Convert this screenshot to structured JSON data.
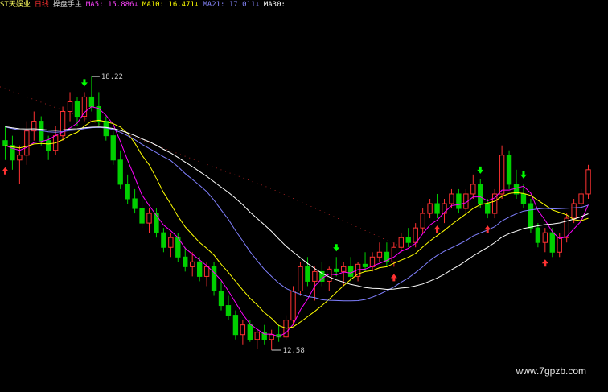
{
  "header": {
    "stock_name": "ST天娱业",
    "period": "日线",
    "indicator_name": "操盘手主",
    "ma5": "MA5: 15.886↓",
    "ma10": "MA10: 16.471↓",
    "ma21": "MA21: 17.011↓",
    "ma30": "MA30:"
  },
  "watermark": "www.7gpzb.com",
  "colors": {
    "up": "#ff3232",
    "down": "#00d000",
    "ma5": "#ff00ff",
    "ma10": "#ffff00",
    "ma21": "#8080ff",
    "ma30": "#ffffff",
    "dotted": "#ff3232",
    "buy": "#ff3232",
    "sell": "#00ff00"
  },
  "chart_data": {
    "type": "candlestick",
    "title": "",
    "ylim": [
      11.8,
      19.5
    ],
    "annotations": {
      "high": {
        "label": "18.22",
        "value": 18.22
      },
      "low": {
        "label": "12.58",
        "value": 12.58
      }
    },
    "candles": [
      [
        16.9,
        17.2,
        16.5,
        16.8
      ],
      [
        16.8,
        17.0,
        16.3,
        16.5
      ],
      [
        16.5,
        16.8,
        16.0,
        16.6
      ],
      [
        16.6,
        17.3,
        16.4,
        17.1
      ],
      [
        17.1,
        17.5,
        16.9,
        17.3
      ],
      [
        17.3,
        17.4,
        16.8,
        16.9
      ],
      [
        16.9,
        17.0,
        16.5,
        16.7
      ],
      [
        16.7,
        17.2,
        16.6,
        17.0
      ],
      [
        17.0,
        17.6,
        16.9,
        17.5
      ],
      [
        17.5,
        17.9,
        17.3,
        17.7
      ],
      [
        17.7,
        17.8,
        17.2,
        17.4
      ],
      [
        17.4,
        17.9,
        17.3,
        17.8
      ],
      [
        17.8,
        18.22,
        17.5,
        17.6
      ],
      [
        17.6,
        17.9,
        17.2,
        17.3
      ],
      [
        17.3,
        17.4,
        16.9,
        17.0
      ],
      [
        17.0,
        17.1,
        16.4,
        16.5
      ],
      [
        16.5,
        16.7,
        15.9,
        16.0
      ],
      [
        16.0,
        16.2,
        15.6,
        15.7
      ],
      [
        15.7,
        15.9,
        15.4,
        15.5
      ],
      [
        15.5,
        15.7,
        15.1,
        15.2
      ],
      [
        15.2,
        15.5,
        15.0,
        15.4
      ],
      [
        15.4,
        15.5,
        14.9,
        15.0
      ],
      [
        15.0,
        15.1,
        14.6,
        14.7
      ],
      [
        14.7,
        15.0,
        14.5,
        14.9
      ],
      [
        14.9,
        15.0,
        14.4,
        14.5
      ],
      [
        14.5,
        14.7,
        14.2,
        14.3
      ],
      [
        14.3,
        14.6,
        14.1,
        14.4
      ],
      [
        14.4,
        14.5,
        14.0,
        14.1
      ],
      [
        14.1,
        14.4,
        13.9,
        14.3
      ],
      [
        14.3,
        14.4,
        13.7,
        13.8
      ],
      [
        13.8,
        14.0,
        13.4,
        13.5
      ],
      [
        13.5,
        13.7,
        13.2,
        13.3
      ],
      [
        13.3,
        13.4,
        12.8,
        12.9
      ],
      [
        12.9,
        13.2,
        12.7,
        13.1
      ],
      [
        13.1,
        13.2,
        12.75,
        12.8
      ],
      [
        12.8,
        13.0,
        12.6,
        12.95
      ],
      [
        12.95,
        13.1,
        12.7,
        12.8
      ],
      [
        12.8,
        13.0,
        12.58,
        12.9
      ],
      [
        12.9,
        13.1,
        12.75,
        12.85
      ],
      [
        12.85,
        13.3,
        12.8,
        13.2
      ],
      [
        13.2,
        13.9,
        13.1,
        13.8
      ],
      [
        13.8,
        14.4,
        13.7,
        14.3
      ],
      [
        14.3,
        14.5,
        13.9,
        14.0
      ],
      [
        14.0,
        14.3,
        13.6,
        14.2
      ],
      [
        14.2,
        14.4,
        13.9,
        14.0
      ],
      [
        14.0,
        14.3,
        13.8,
        14.25
      ],
      [
        14.25,
        14.5,
        14.1,
        14.2
      ],
      [
        14.2,
        14.4,
        13.9,
        14.3
      ],
      [
        14.3,
        14.5,
        14.0,
        14.1
      ],
      [
        14.1,
        14.4,
        14.0,
        14.35
      ],
      [
        14.35,
        14.6,
        14.2,
        14.3
      ],
      [
        14.3,
        14.6,
        14.2,
        14.5
      ],
      [
        14.5,
        14.8,
        14.4,
        14.6
      ],
      [
        14.6,
        14.8,
        14.3,
        14.4
      ],
      [
        14.4,
        14.8,
        14.3,
        14.7
      ],
      [
        14.7,
        15.0,
        14.6,
        14.9
      ],
      [
        14.9,
        15.1,
        14.7,
        14.8
      ],
      [
        14.8,
        15.2,
        14.7,
        15.1
      ],
      [
        15.1,
        15.5,
        15.0,
        15.4
      ],
      [
        15.4,
        15.7,
        15.3,
        15.6
      ],
      [
        15.6,
        15.8,
        15.3,
        15.4
      ],
      [
        15.4,
        15.7,
        15.2,
        15.6
      ],
      [
        15.6,
        15.9,
        15.5,
        15.8
      ],
      [
        15.8,
        15.9,
        15.4,
        15.5
      ],
      [
        15.5,
        15.9,
        15.4,
        15.8
      ],
      [
        15.8,
        16.2,
        15.7,
        16.0
      ],
      [
        16.0,
        16.1,
        15.5,
        15.6
      ],
      [
        15.6,
        15.7,
        15.3,
        15.4
      ],
      [
        15.4,
        15.9,
        15.3,
        15.8
      ],
      [
        15.8,
        16.8,
        15.7,
        16.6
      ],
      [
        16.6,
        16.7,
        15.9,
        16.0
      ],
      [
        16.0,
        16.3,
        15.7,
        15.8
      ],
      [
        15.8,
        16.0,
        15.5,
        15.6
      ],
      [
        15.6,
        15.7,
        15.0,
        15.1
      ],
      [
        15.1,
        15.2,
        14.7,
        14.8
      ],
      [
        14.8,
        15.1,
        14.6,
        15.0
      ],
      [
        15.0,
        15.1,
        14.5,
        14.6
      ],
      [
        14.6,
        15.0,
        14.5,
        14.9
      ],
      [
        14.9,
        15.4,
        14.8,
        15.3
      ],
      [
        15.3,
        15.7,
        15.2,
        15.6
      ],
      [
        15.6,
        15.9,
        15.5,
        15.8
      ],
      [
        15.8,
        16.4,
        15.7,
        16.3
      ]
    ],
    "buy_signals": [
      0,
      54,
      60,
      67,
      75
    ],
    "sell_signals": [
      11,
      46,
      66,
      72
    ]
  }
}
